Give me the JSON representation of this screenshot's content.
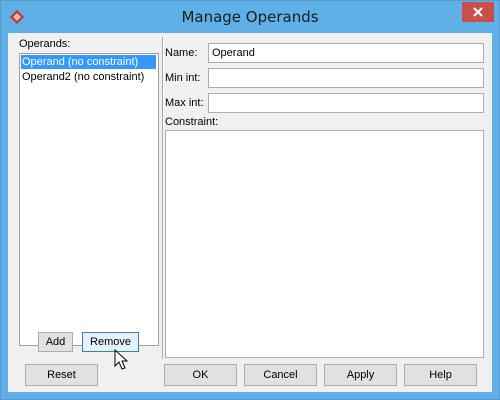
{
  "window": {
    "title": "Manage Operands"
  },
  "operands": {
    "label": "Operands:",
    "items": [
      {
        "label": "Operand (no constraint)",
        "selected": true
      },
      {
        "label": "Operand2 (no constraint)",
        "selected": false
      }
    ],
    "add_label": "Add",
    "remove_label": "Remove"
  },
  "details": {
    "name_label": "Name:",
    "name_value": "Operand",
    "min_label": "Min int:",
    "min_value": "",
    "max_label": "Max int:",
    "max_value": "",
    "constraint_label": "Constraint:",
    "constraint_value": ""
  },
  "footer": {
    "reset_label": "Reset",
    "ok_label": "OK",
    "cancel_label": "Cancel",
    "apply_label": "Apply",
    "help_label": "Help"
  },
  "colors": {
    "titlebar": "#5fb0e6",
    "selection": "#3399ff",
    "close": "#c7504a"
  }
}
